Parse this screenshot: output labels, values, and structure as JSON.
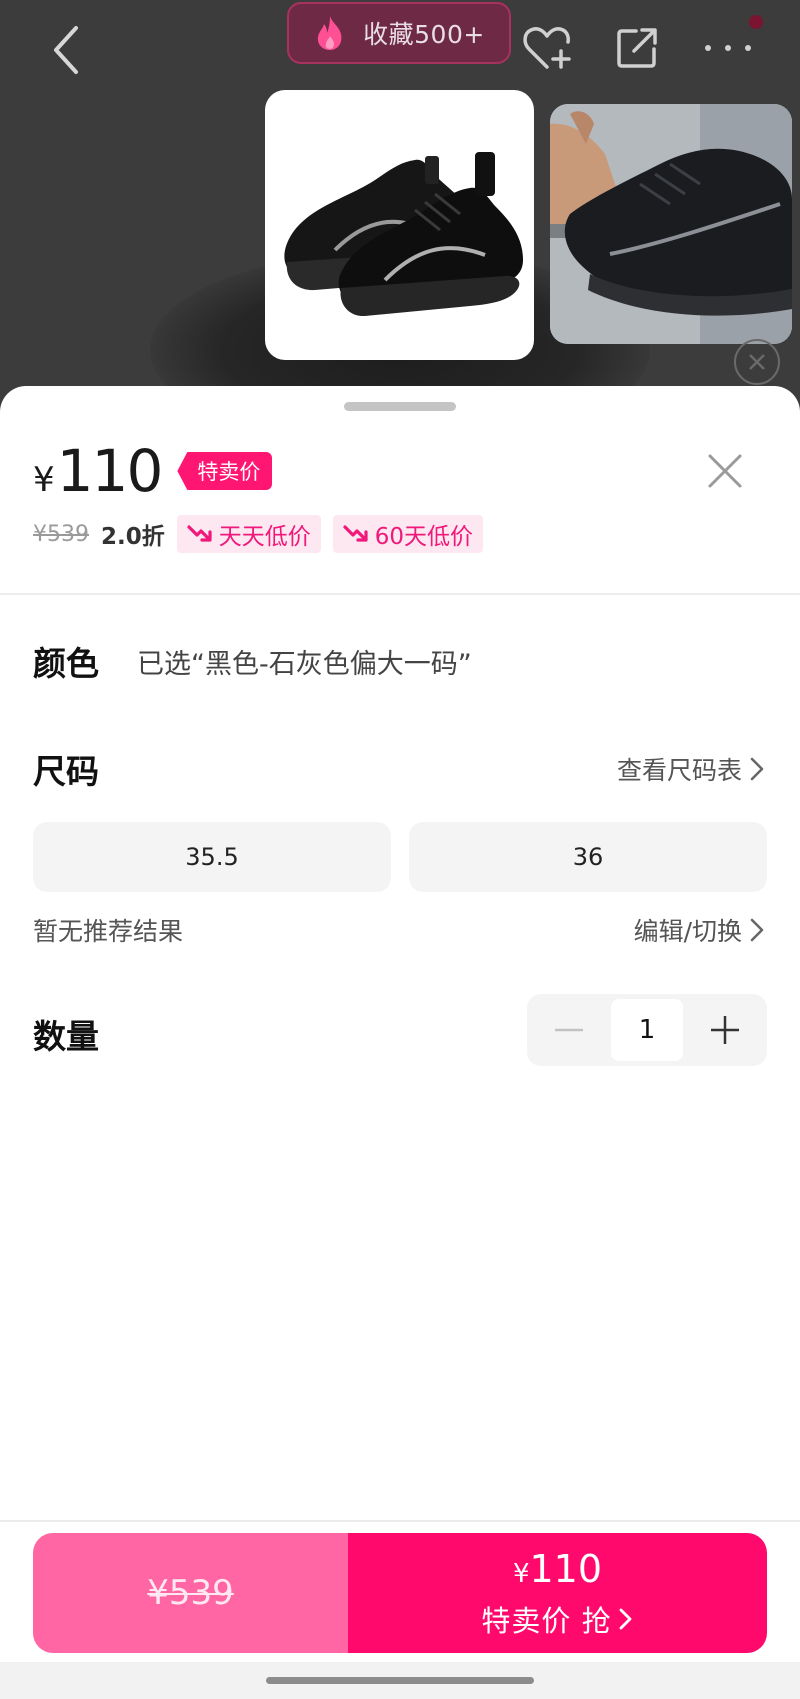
{
  "header": {
    "favorite_count_label": "收藏500+"
  },
  "sheet": {
    "price": {
      "currency": "¥",
      "value": "110",
      "tag": "特卖价",
      "original": "¥539",
      "discount": "2.0折",
      "low_tags": [
        "天天低价",
        "60天低价"
      ]
    },
    "color": {
      "label": "颜色",
      "selected": "已选“黑色-石灰色偏大一码”"
    },
    "size": {
      "label": "尺码",
      "chart_link": "查看尺码表",
      "options": [
        "35.5",
        "36"
      ],
      "recommendation": "暂无推荐结果",
      "edit_link": "编辑/切换"
    },
    "quantity": {
      "label": "数量",
      "value": "1"
    }
  },
  "buy_bar": {
    "original_price": "¥539",
    "currency": "¥",
    "price": "110",
    "action_label": "特卖价 抢"
  },
  "colors": {
    "accent": "#ff0a6c",
    "accent_light": "#ff66a3",
    "tag_bg": "#fde7f1"
  },
  "icons": [
    "back-arrow-icon",
    "flame-icon",
    "heart-plus-icon",
    "share-icon",
    "more-icon",
    "close-icon",
    "chevron-right-icon",
    "minus-icon",
    "plus-icon",
    "trend-down-icon"
  ]
}
